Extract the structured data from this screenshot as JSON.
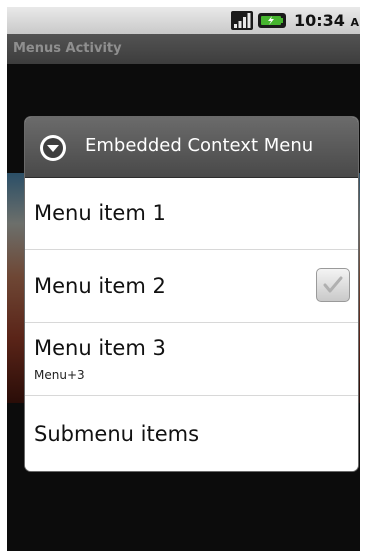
{
  "status_bar": {
    "time": "10:34",
    "ampm": "AM",
    "signal_icon": "signal-strength-icon",
    "battery_icon": "battery-charging-icon"
  },
  "activity": {
    "title": "Menus Activity"
  },
  "dialog": {
    "title": "Embedded Context Menu",
    "header_icon": "dropdown-circle-icon",
    "items": [
      {
        "label": "Menu item 1"
      },
      {
        "label": "Menu item 2",
        "checked": true
      },
      {
        "label": "Menu item 3",
        "shortcut": "Menu+3"
      },
      {
        "label": "Submenu items"
      }
    ]
  },
  "colors": {
    "dialog_header": "#555555",
    "screen_background": "#0c0c0c",
    "status_bar": "#d6d6d6"
  }
}
